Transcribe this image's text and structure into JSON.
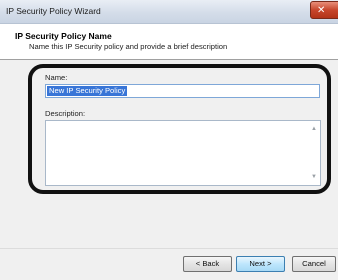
{
  "window": {
    "title": "IP Security Policy Wizard",
    "close_label": "✕"
  },
  "header": {
    "title": "IP Security Policy Name",
    "description": "Name this IP Security policy and provide a brief description"
  },
  "form": {
    "name_label": "Name:",
    "name_value": "New IP Security Policy",
    "description_label": "Description:",
    "description_value": ""
  },
  "buttons": {
    "back": "< Back",
    "next": "Next >",
    "cancel": "Cancel"
  },
  "colors": {
    "selection": "#3875d7",
    "close": "#c7462c",
    "callout": "#111111"
  }
}
